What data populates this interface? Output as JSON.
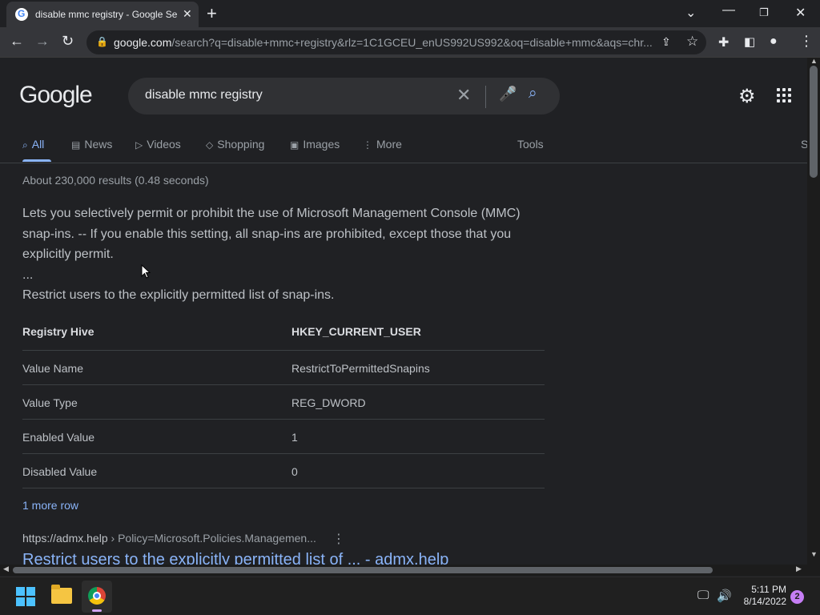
{
  "browser": {
    "tab_title": "disable mmc registry - Google Se",
    "url_domain": "google.com",
    "url_rest": "/search?q=disable+mmc+registry&rlz=1C1GCEU_enUS992US992&oq=disable+mmc&aqs=chr..."
  },
  "google": {
    "logo": "Google",
    "query": "disable mmc registry",
    "nav_tabs": [
      {
        "label": "All",
        "icon": "search-icon"
      },
      {
        "label": "News",
        "icon": "news-icon"
      },
      {
        "label": "Videos",
        "icon": "video-icon"
      },
      {
        "label": "Shopping",
        "icon": "tag-icon"
      },
      {
        "label": "Images",
        "icon": "image-icon"
      },
      {
        "label": "More",
        "icon": "more-vert-icon"
      }
    ],
    "tools": "Tools",
    "cut_label": "S",
    "stats": "About 230,000 results (0.48 seconds)"
  },
  "snippet": {
    "text": "Lets you selectively permit or prohibit the use of Microsoft Management Console (MMC) snap-ins. -- If you enable this setting, all snap-ins are prohibited, except those that you explicitly permit.",
    "ellipsis": "...",
    "summary": "Restrict users to the explicitly permitted list of snap-ins."
  },
  "table": {
    "header": {
      "key": "Registry Hive",
      "value": "HKEY_CURRENT_USER"
    },
    "rows": [
      {
        "key": "Value Name",
        "value": "RestrictToPermittedSnapins"
      },
      {
        "key": "Value Type",
        "value": "REG_DWORD"
      },
      {
        "key": "Enabled Value",
        "value": "1"
      },
      {
        "key": "Disabled Value",
        "value": "0"
      }
    ],
    "more": "1 more row"
  },
  "result": {
    "cite_domain": "https://admx.help",
    "cite_path": " › Policy=Microsoft.Policies.Managemen...",
    "title": "Restrict users to the explicitly permitted list of ... - admx.help"
  },
  "taskbar": {
    "time": "5:11 PM",
    "date": "8/14/2022",
    "notifications": "2"
  },
  "colors": {
    "background": "#202124",
    "link": "#8ab4f8",
    "text": "#bdc1c6"
  }
}
